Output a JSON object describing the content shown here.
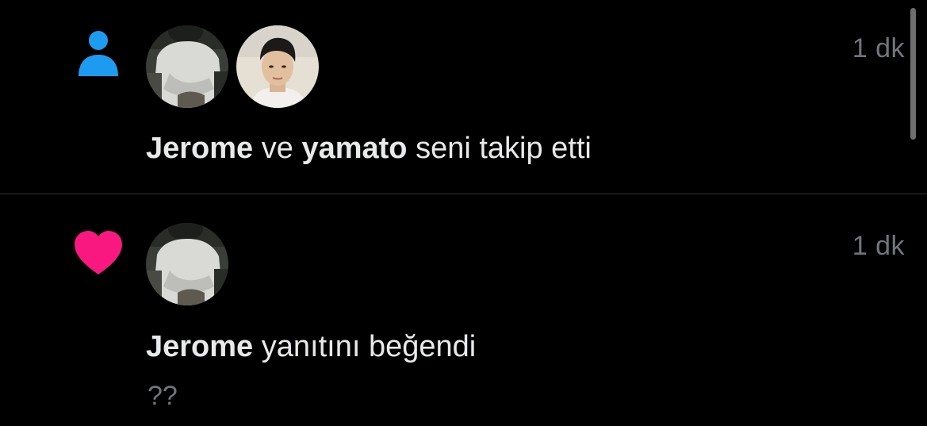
{
  "notifications": [
    {
      "type": "follow",
      "type_icon": "person-icon",
      "icon_color": "#1d9bf0",
      "timestamp": "1 dk",
      "actors": [
        "Jerome",
        "yamato"
      ],
      "joiner": " ve ",
      "action_text": " seni takip etti"
    },
    {
      "type": "like",
      "type_icon": "heart-icon",
      "icon_color": "#f91880",
      "timestamp": "1 dk",
      "actors": [
        "Jerome"
      ],
      "action_text": " yanıtını beğendi",
      "preview": "??"
    }
  ],
  "colors": {
    "background": "#000000",
    "text_primary": "#e7e9ea",
    "text_secondary": "#71767b",
    "divider": "#2f3336"
  }
}
